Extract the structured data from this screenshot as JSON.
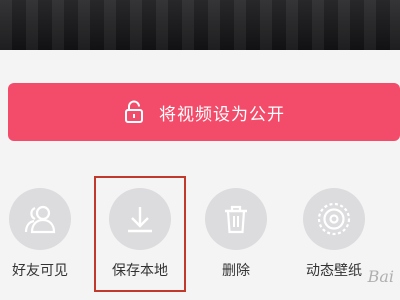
{
  "sheet": {
    "public_button": {
      "label": "将视频设为公开",
      "icon": "unlock-icon",
      "color": "#f34c6a"
    },
    "actions": [
      {
        "label": "好友可见",
        "icon": "friends-icon"
      },
      {
        "label": "保存本地",
        "icon": "download-icon"
      },
      {
        "label": "删除",
        "icon": "trash-icon"
      },
      {
        "label": "动态壁纸",
        "icon": "dynamic-wallpaper-icon"
      }
    ]
  },
  "watermark": "Bai"
}
